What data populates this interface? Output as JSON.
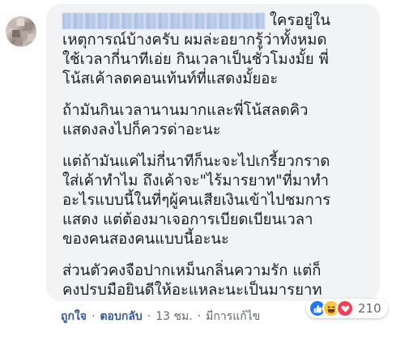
{
  "comment": {
    "author_suffix": "ใครอยู่ใน",
    "paragraphs": [
      {
        "lines": [
          "เหตุการณ์บ้างครับ ผมล่ะอยากรู้ว่าทั้งหมด",
          "ใช้เวลากี่นาทีเอ่ย กินเวลาเป็นชั่วโมงมั้ย พี่",
          "โน้สเค้าลดคอนเท้นท์ที่แสดงมั้ยอะ"
        ]
      },
      {
        "lines": [
          "ถ้ามันกินเวลานานมากและพี่โน้สลดคิว",
          "แสดงลงไปก็ควรด่าอะนะ"
        ]
      },
      {
        "lines": [
          "แต่ถ้ามันแค่ไม่กี่นาทีก็นะจะไปเกรี้ยวกราด",
          "ใส่เค้าทำไม ถึงเค้าจะ\"ไร้มารยาท\"ที่มาทำ",
          "อะไรแบบนี้ในที่ๆผู้คนเสียเงินเข้าไปชมการ",
          "แสดง แต่ต้องมาเจอการเบียดเบียนเวลา",
          "ของคนสองคนแบบนี้อะนะ"
        ]
      },
      {
        "lines": [
          "ส่วนตัวคงจือปากเหม็นกลิ่นความรัก แต่ก็",
          "คงปรบมือยินดีให้อะแหละนะเป็นมารยาท"
        ]
      }
    ]
  },
  "actions": {
    "like": "ถูกใจ",
    "reply": "ตอบกลับ",
    "time": "13 ชม.",
    "edited": "มีการแก้ไข",
    "separator": "·"
  },
  "reactions": {
    "icons": [
      "like-icon",
      "haha-icon",
      "love-icon"
    ],
    "count": "210",
    "colors": {
      "like": "#2078f4",
      "haha": "#f7c63b",
      "love": "#f33e58"
    }
  }
}
